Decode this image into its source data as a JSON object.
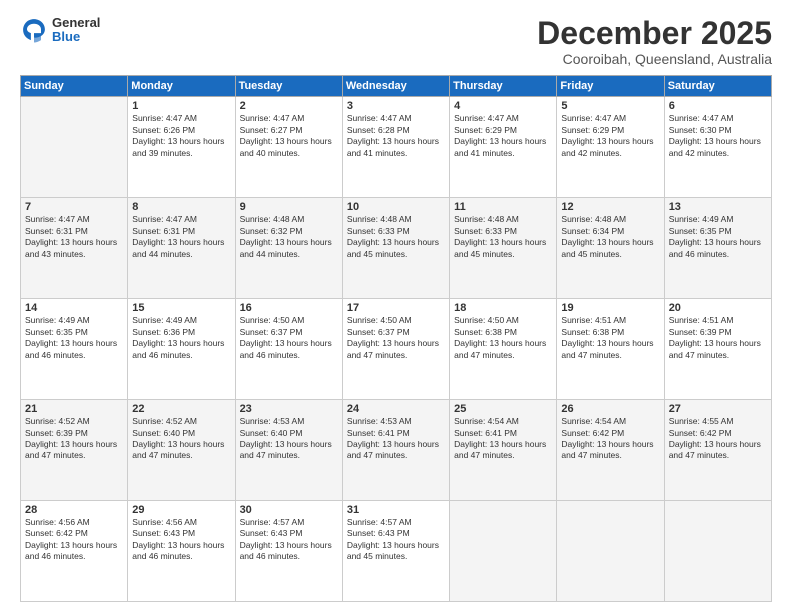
{
  "logo": {
    "general": "General",
    "blue": "Blue"
  },
  "header": {
    "month": "December 2025",
    "location": "Cooroibah, Queensland, Australia"
  },
  "days": [
    "Sunday",
    "Monday",
    "Tuesday",
    "Wednesday",
    "Thursday",
    "Friday",
    "Saturday"
  ],
  "weeks": [
    [
      {
        "day": "",
        "sunrise": "",
        "sunset": "",
        "daylight": ""
      },
      {
        "day": "1",
        "sunrise": "Sunrise: 4:47 AM",
        "sunset": "Sunset: 6:26 PM",
        "daylight": "Daylight: 13 hours and 39 minutes."
      },
      {
        "day": "2",
        "sunrise": "Sunrise: 4:47 AM",
        "sunset": "Sunset: 6:27 PM",
        "daylight": "Daylight: 13 hours and 40 minutes."
      },
      {
        "day": "3",
        "sunrise": "Sunrise: 4:47 AM",
        "sunset": "Sunset: 6:28 PM",
        "daylight": "Daylight: 13 hours and 41 minutes."
      },
      {
        "day": "4",
        "sunrise": "Sunrise: 4:47 AM",
        "sunset": "Sunset: 6:29 PM",
        "daylight": "Daylight: 13 hours and 41 minutes."
      },
      {
        "day": "5",
        "sunrise": "Sunrise: 4:47 AM",
        "sunset": "Sunset: 6:29 PM",
        "daylight": "Daylight: 13 hours and 42 minutes."
      },
      {
        "day": "6",
        "sunrise": "Sunrise: 4:47 AM",
        "sunset": "Sunset: 6:30 PM",
        "daylight": "Daylight: 13 hours and 42 minutes."
      }
    ],
    [
      {
        "day": "7",
        "sunrise": "Sunrise: 4:47 AM",
        "sunset": "Sunset: 6:31 PM",
        "daylight": "Daylight: 13 hours and 43 minutes."
      },
      {
        "day": "8",
        "sunrise": "Sunrise: 4:47 AM",
        "sunset": "Sunset: 6:31 PM",
        "daylight": "Daylight: 13 hours and 44 minutes."
      },
      {
        "day": "9",
        "sunrise": "Sunrise: 4:48 AM",
        "sunset": "Sunset: 6:32 PM",
        "daylight": "Daylight: 13 hours and 44 minutes."
      },
      {
        "day": "10",
        "sunrise": "Sunrise: 4:48 AM",
        "sunset": "Sunset: 6:33 PM",
        "daylight": "Daylight: 13 hours and 45 minutes."
      },
      {
        "day": "11",
        "sunrise": "Sunrise: 4:48 AM",
        "sunset": "Sunset: 6:33 PM",
        "daylight": "Daylight: 13 hours and 45 minutes."
      },
      {
        "day": "12",
        "sunrise": "Sunrise: 4:48 AM",
        "sunset": "Sunset: 6:34 PM",
        "daylight": "Daylight: 13 hours and 45 minutes."
      },
      {
        "day": "13",
        "sunrise": "Sunrise: 4:49 AM",
        "sunset": "Sunset: 6:35 PM",
        "daylight": "Daylight: 13 hours and 46 minutes."
      }
    ],
    [
      {
        "day": "14",
        "sunrise": "Sunrise: 4:49 AM",
        "sunset": "Sunset: 6:35 PM",
        "daylight": "Daylight: 13 hours and 46 minutes."
      },
      {
        "day": "15",
        "sunrise": "Sunrise: 4:49 AM",
        "sunset": "Sunset: 6:36 PM",
        "daylight": "Daylight: 13 hours and 46 minutes."
      },
      {
        "day": "16",
        "sunrise": "Sunrise: 4:50 AM",
        "sunset": "Sunset: 6:37 PM",
        "daylight": "Daylight: 13 hours and 46 minutes."
      },
      {
        "day": "17",
        "sunrise": "Sunrise: 4:50 AM",
        "sunset": "Sunset: 6:37 PM",
        "daylight": "Daylight: 13 hours and 47 minutes."
      },
      {
        "day": "18",
        "sunrise": "Sunrise: 4:50 AM",
        "sunset": "Sunset: 6:38 PM",
        "daylight": "Daylight: 13 hours and 47 minutes."
      },
      {
        "day": "19",
        "sunrise": "Sunrise: 4:51 AM",
        "sunset": "Sunset: 6:38 PM",
        "daylight": "Daylight: 13 hours and 47 minutes."
      },
      {
        "day": "20",
        "sunrise": "Sunrise: 4:51 AM",
        "sunset": "Sunset: 6:39 PM",
        "daylight": "Daylight: 13 hours and 47 minutes."
      }
    ],
    [
      {
        "day": "21",
        "sunrise": "Sunrise: 4:52 AM",
        "sunset": "Sunset: 6:39 PM",
        "daylight": "Daylight: 13 hours and 47 minutes."
      },
      {
        "day": "22",
        "sunrise": "Sunrise: 4:52 AM",
        "sunset": "Sunset: 6:40 PM",
        "daylight": "Daylight: 13 hours and 47 minutes."
      },
      {
        "day": "23",
        "sunrise": "Sunrise: 4:53 AM",
        "sunset": "Sunset: 6:40 PM",
        "daylight": "Daylight: 13 hours and 47 minutes."
      },
      {
        "day": "24",
        "sunrise": "Sunrise: 4:53 AM",
        "sunset": "Sunset: 6:41 PM",
        "daylight": "Daylight: 13 hours and 47 minutes."
      },
      {
        "day": "25",
        "sunrise": "Sunrise: 4:54 AM",
        "sunset": "Sunset: 6:41 PM",
        "daylight": "Daylight: 13 hours and 47 minutes."
      },
      {
        "day": "26",
        "sunrise": "Sunrise: 4:54 AM",
        "sunset": "Sunset: 6:42 PM",
        "daylight": "Daylight: 13 hours and 47 minutes."
      },
      {
        "day": "27",
        "sunrise": "Sunrise: 4:55 AM",
        "sunset": "Sunset: 6:42 PM",
        "daylight": "Daylight: 13 hours and 47 minutes."
      }
    ],
    [
      {
        "day": "28",
        "sunrise": "Sunrise: 4:56 AM",
        "sunset": "Sunset: 6:42 PM",
        "daylight": "Daylight: 13 hours and 46 minutes."
      },
      {
        "day": "29",
        "sunrise": "Sunrise: 4:56 AM",
        "sunset": "Sunset: 6:43 PM",
        "daylight": "Daylight: 13 hours and 46 minutes."
      },
      {
        "day": "30",
        "sunrise": "Sunrise: 4:57 AM",
        "sunset": "Sunset: 6:43 PM",
        "daylight": "Daylight: 13 hours and 46 minutes."
      },
      {
        "day": "31",
        "sunrise": "Sunrise: 4:57 AM",
        "sunset": "Sunset: 6:43 PM",
        "daylight": "Daylight: 13 hours and 45 minutes."
      },
      {
        "day": "",
        "sunrise": "",
        "sunset": "",
        "daylight": ""
      },
      {
        "day": "",
        "sunrise": "",
        "sunset": "",
        "daylight": ""
      },
      {
        "day": "",
        "sunrise": "",
        "sunset": "",
        "daylight": ""
      }
    ]
  ]
}
